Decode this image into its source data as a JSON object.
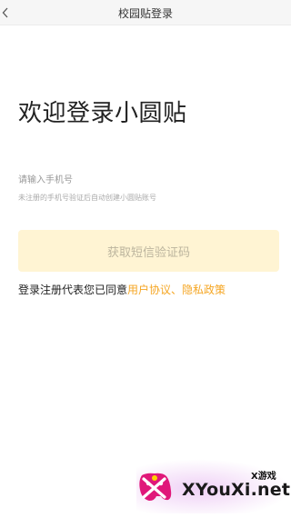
{
  "header": {
    "title": "校园贴登录",
    "back_icon": "chevron-left-icon"
  },
  "welcome": {
    "title": "欢迎登录小圆贴"
  },
  "phone": {
    "placeholder": "请输入手机号",
    "value": ""
  },
  "hint": {
    "text": "未注册的手机号验证后自动创建小圆贴账号"
  },
  "sms_button": {
    "label": "获取短信验证码",
    "bg_color": "#fff4d3",
    "text_color": "#bcb59e"
  },
  "agreement": {
    "prefix": "登录注册代表您已同意",
    "user_agreement": "用户协议",
    "separator": "、",
    "privacy_policy": "隐私政策",
    "link_color": "#f5a623"
  },
  "watermark": {
    "cn": "X游戏",
    "en": "XYouXi.net",
    "icon": "gamepad-x-logo-icon"
  }
}
